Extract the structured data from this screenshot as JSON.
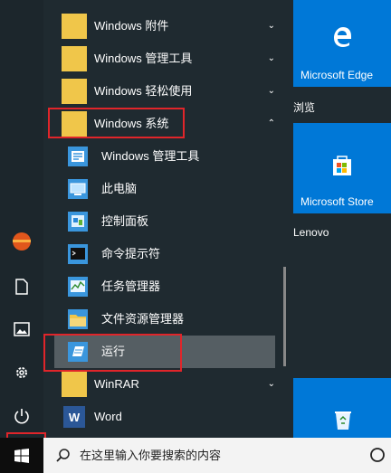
{
  "app_list": {
    "items": [
      {
        "label": "Windows 附件",
        "chevron": "⌄",
        "icon": "folder-icon"
      },
      {
        "label": "Windows 管理工具",
        "chevron": "⌄",
        "icon": "folder-icon"
      },
      {
        "label": "Windows 轻松使用",
        "chevron": "⌄",
        "icon": "folder-icon"
      },
      {
        "label": "Windows 系统",
        "chevron": "⌃",
        "icon": "folder-icon"
      },
      {
        "label": "Windows 管理工具",
        "icon": "admin-tools-icon"
      },
      {
        "label": "此电脑",
        "icon": "this-pc-icon"
      },
      {
        "label": "控制面板",
        "icon": "control-panel-icon"
      },
      {
        "label": "命令提示符",
        "icon": "command-prompt-icon"
      },
      {
        "label": "任务管理器",
        "icon": "task-manager-icon"
      },
      {
        "label": "文件资源管理器",
        "icon": "file-explorer-icon"
      },
      {
        "label": "运行",
        "icon": "run-icon"
      },
      {
        "label": "WinRAR",
        "chevron": "⌄",
        "icon": "folder-icon"
      },
      {
        "label": "Word",
        "icon": "word-icon"
      }
    ]
  },
  "tiles": {
    "edge_label": "Microsoft Edge",
    "group_browse": "浏览",
    "store_label": "Microsoft Store",
    "group_lenovo": "Lenovo"
  },
  "taskbar": {
    "search_placeholder": "在这里输入你要搜索的内容"
  },
  "colors": {
    "accent": "#0078d7",
    "highlight": "#e0252a",
    "folder": "#f0c64a"
  }
}
